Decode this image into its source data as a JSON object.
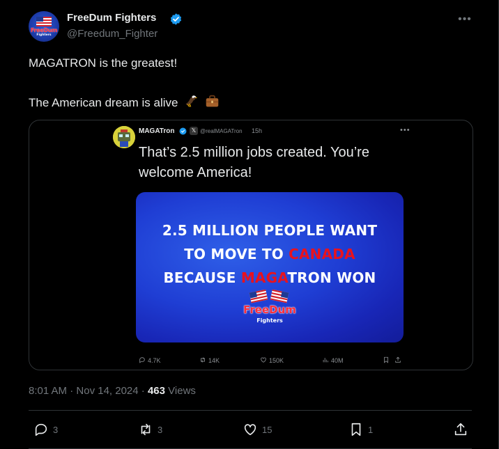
{
  "author": {
    "display_name": "FreeDum Fighters",
    "handle": "@Freedum_Fighter",
    "avatar_text": "FreeDum",
    "avatar_subtext": "Fighters"
  },
  "tweet": {
    "line1": "MAGATRON is the greatest!",
    "line2": "The American dream is alive",
    "emojis": [
      "eagle-emoji",
      "briefcase-emoji"
    ]
  },
  "quote": {
    "name": "MAGATron",
    "handle": "@realMAGATron",
    "time": "15h",
    "text": "That’s 2.5 million jobs created. You’re welcome America!",
    "banner": {
      "line1": "2.5 MILLION PEOPLE WANT",
      "line2_a": "TO MOVE TO ",
      "line2_red": "CANADA",
      "line3_red": "MAGA",
      "line3_a": "BECAUSE ",
      "line3_b": "TRON WON",
      "brand": "FreeDum",
      "brand_sub": "Fighters"
    },
    "stats": {
      "replies": "4.7K",
      "reposts": "14K",
      "likes": "150K",
      "views": "40M"
    }
  },
  "meta": {
    "time": "8:01 AM",
    "date": "Nov 14, 2024",
    "views_count": "463",
    "views_label": "Views",
    "sep": " · "
  },
  "actions": {
    "replies": "3",
    "reposts": "3",
    "likes": "15",
    "bookmarks": "1"
  },
  "colors": {
    "accent_blue": "#1d9bf0",
    "text_secondary": "#71767b",
    "banner_red": "#e8121e"
  }
}
